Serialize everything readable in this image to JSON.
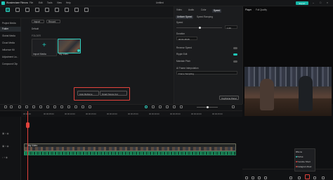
{
  "app": {
    "title": "Wondershare Filmora",
    "document": "Untitled",
    "export_label": "Export",
    "menu": [
      "File",
      "Edit",
      "Tools",
      "View",
      "Help"
    ]
  },
  "toolbar": {
    "items": [
      "Media",
      "Stock Media",
      "Audio",
      "Titles",
      "Transitions",
      "Effects",
      "Filters",
      "Stickers",
      "Templates"
    ]
  },
  "sidebar": {
    "items": [
      "Project Media",
      "Folder",
      "Global Media",
      "Cloud Media",
      "Influence Kit",
      "Adjustment La...",
      "Compound Clip"
    ]
  },
  "media": {
    "import_label": "Import",
    "record_label": "Record",
    "filter_label": "Default",
    "folder_label": "FOLDER",
    "import_tile": "Import Media",
    "clip_name": "My Video",
    "auto_reframe": "Auto Reframe",
    "smart_scene": "Smart Scene Cut"
  },
  "props": {
    "tabs": [
      "Video",
      "Audio",
      "Color",
      "Speed"
    ],
    "subtabs": [
      "Uniform Speed",
      "Speed Ramping"
    ],
    "speed_label": "Speed",
    "speed_value": "1.00",
    "duration_label": "Duration",
    "duration_value": "00:01:28:25",
    "reverse_label": "Reverse Speed",
    "ripple_label": "Ripple Edit",
    "pitch_label": "Maintain Pitch",
    "interp_label": "AI Frame Interpolation",
    "interp_value": "Frame Sampling",
    "reset_label": "Keyframe Panel"
  },
  "player": {
    "tab": "Player",
    "quality": "Full Quality"
  },
  "timeline": {
    "ticks": [
      "00:00:00",
      "00:00:05:00",
      "00:00:10:00",
      "00:00:15:00",
      "00:00:20:00",
      "00:00:25:00",
      "00:00:30:00",
      "00:00:35:00",
      "00:00:40:00",
      "00:00:45:00"
    ],
    "clip_label": "My Video"
  },
  "popup": {
    "items": [
      "None",
      "TikTok",
      "Youtube Short",
      "Instagram Reel"
    ],
    "colors": [
      "#888888",
      "#2fd0c0",
      "#e2423b",
      "#e2423b"
    ]
  }
}
